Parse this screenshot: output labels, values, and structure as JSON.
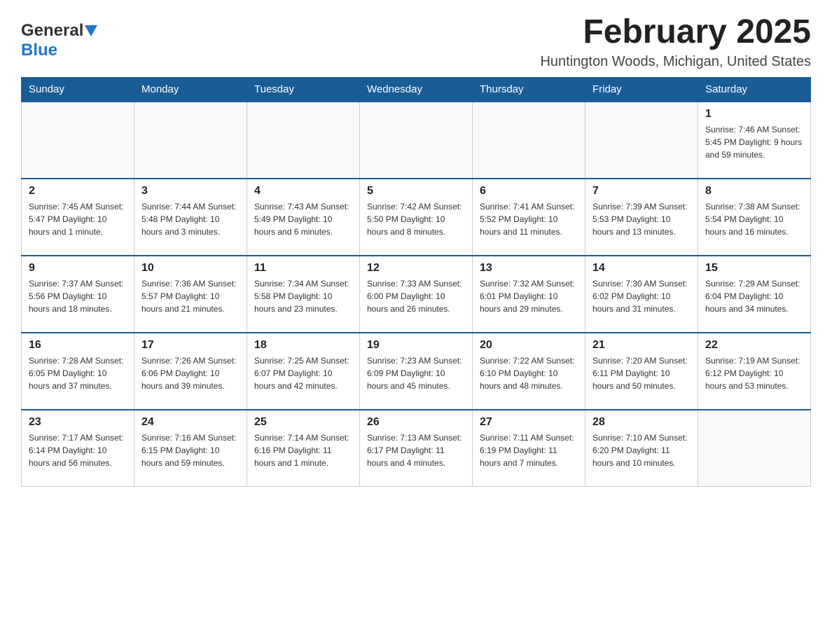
{
  "header": {
    "logo_general": "General",
    "logo_blue": "Blue",
    "month_title": "February 2025",
    "location": "Huntington Woods, Michigan, United States"
  },
  "days_of_week": [
    "Sunday",
    "Monday",
    "Tuesday",
    "Wednesday",
    "Thursday",
    "Friday",
    "Saturday"
  ],
  "weeks": [
    [
      {
        "day": "",
        "info": ""
      },
      {
        "day": "",
        "info": ""
      },
      {
        "day": "",
        "info": ""
      },
      {
        "day": "",
        "info": ""
      },
      {
        "day": "",
        "info": ""
      },
      {
        "day": "",
        "info": ""
      },
      {
        "day": "1",
        "info": "Sunrise: 7:46 AM\nSunset: 5:45 PM\nDaylight: 9 hours\nand 59 minutes."
      }
    ],
    [
      {
        "day": "2",
        "info": "Sunrise: 7:45 AM\nSunset: 5:47 PM\nDaylight: 10 hours\nand 1 minute."
      },
      {
        "day": "3",
        "info": "Sunrise: 7:44 AM\nSunset: 5:48 PM\nDaylight: 10 hours\nand 3 minutes."
      },
      {
        "day": "4",
        "info": "Sunrise: 7:43 AM\nSunset: 5:49 PM\nDaylight: 10 hours\nand 6 minutes."
      },
      {
        "day": "5",
        "info": "Sunrise: 7:42 AM\nSunset: 5:50 PM\nDaylight: 10 hours\nand 8 minutes."
      },
      {
        "day": "6",
        "info": "Sunrise: 7:41 AM\nSunset: 5:52 PM\nDaylight: 10 hours\nand 11 minutes."
      },
      {
        "day": "7",
        "info": "Sunrise: 7:39 AM\nSunset: 5:53 PM\nDaylight: 10 hours\nand 13 minutes."
      },
      {
        "day": "8",
        "info": "Sunrise: 7:38 AM\nSunset: 5:54 PM\nDaylight: 10 hours\nand 16 minutes."
      }
    ],
    [
      {
        "day": "9",
        "info": "Sunrise: 7:37 AM\nSunset: 5:56 PM\nDaylight: 10 hours\nand 18 minutes."
      },
      {
        "day": "10",
        "info": "Sunrise: 7:36 AM\nSunset: 5:57 PM\nDaylight: 10 hours\nand 21 minutes."
      },
      {
        "day": "11",
        "info": "Sunrise: 7:34 AM\nSunset: 5:58 PM\nDaylight: 10 hours\nand 23 minutes."
      },
      {
        "day": "12",
        "info": "Sunrise: 7:33 AM\nSunset: 6:00 PM\nDaylight: 10 hours\nand 26 minutes."
      },
      {
        "day": "13",
        "info": "Sunrise: 7:32 AM\nSunset: 6:01 PM\nDaylight: 10 hours\nand 29 minutes."
      },
      {
        "day": "14",
        "info": "Sunrise: 7:30 AM\nSunset: 6:02 PM\nDaylight: 10 hours\nand 31 minutes."
      },
      {
        "day": "15",
        "info": "Sunrise: 7:29 AM\nSunset: 6:04 PM\nDaylight: 10 hours\nand 34 minutes."
      }
    ],
    [
      {
        "day": "16",
        "info": "Sunrise: 7:28 AM\nSunset: 6:05 PM\nDaylight: 10 hours\nand 37 minutes."
      },
      {
        "day": "17",
        "info": "Sunrise: 7:26 AM\nSunset: 6:06 PM\nDaylight: 10 hours\nand 39 minutes."
      },
      {
        "day": "18",
        "info": "Sunrise: 7:25 AM\nSunset: 6:07 PM\nDaylight: 10 hours\nand 42 minutes."
      },
      {
        "day": "19",
        "info": "Sunrise: 7:23 AM\nSunset: 6:09 PM\nDaylight: 10 hours\nand 45 minutes."
      },
      {
        "day": "20",
        "info": "Sunrise: 7:22 AM\nSunset: 6:10 PM\nDaylight: 10 hours\nand 48 minutes."
      },
      {
        "day": "21",
        "info": "Sunrise: 7:20 AM\nSunset: 6:11 PM\nDaylight: 10 hours\nand 50 minutes."
      },
      {
        "day": "22",
        "info": "Sunrise: 7:19 AM\nSunset: 6:12 PM\nDaylight: 10 hours\nand 53 minutes."
      }
    ],
    [
      {
        "day": "23",
        "info": "Sunrise: 7:17 AM\nSunset: 6:14 PM\nDaylight: 10 hours\nand 56 minutes."
      },
      {
        "day": "24",
        "info": "Sunrise: 7:16 AM\nSunset: 6:15 PM\nDaylight: 10 hours\nand 59 minutes."
      },
      {
        "day": "25",
        "info": "Sunrise: 7:14 AM\nSunset: 6:16 PM\nDaylight: 11 hours\nand 1 minute."
      },
      {
        "day": "26",
        "info": "Sunrise: 7:13 AM\nSunset: 6:17 PM\nDaylight: 11 hours\nand 4 minutes."
      },
      {
        "day": "27",
        "info": "Sunrise: 7:11 AM\nSunset: 6:19 PM\nDaylight: 11 hours\nand 7 minutes."
      },
      {
        "day": "28",
        "info": "Sunrise: 7:10 AM\nSunset: 6:20 PM\nDaylight: 11 hours\nand 10 minutes."
      },
      {
        "day": "",
        "info": ""
      }
    ]
  ]
}
